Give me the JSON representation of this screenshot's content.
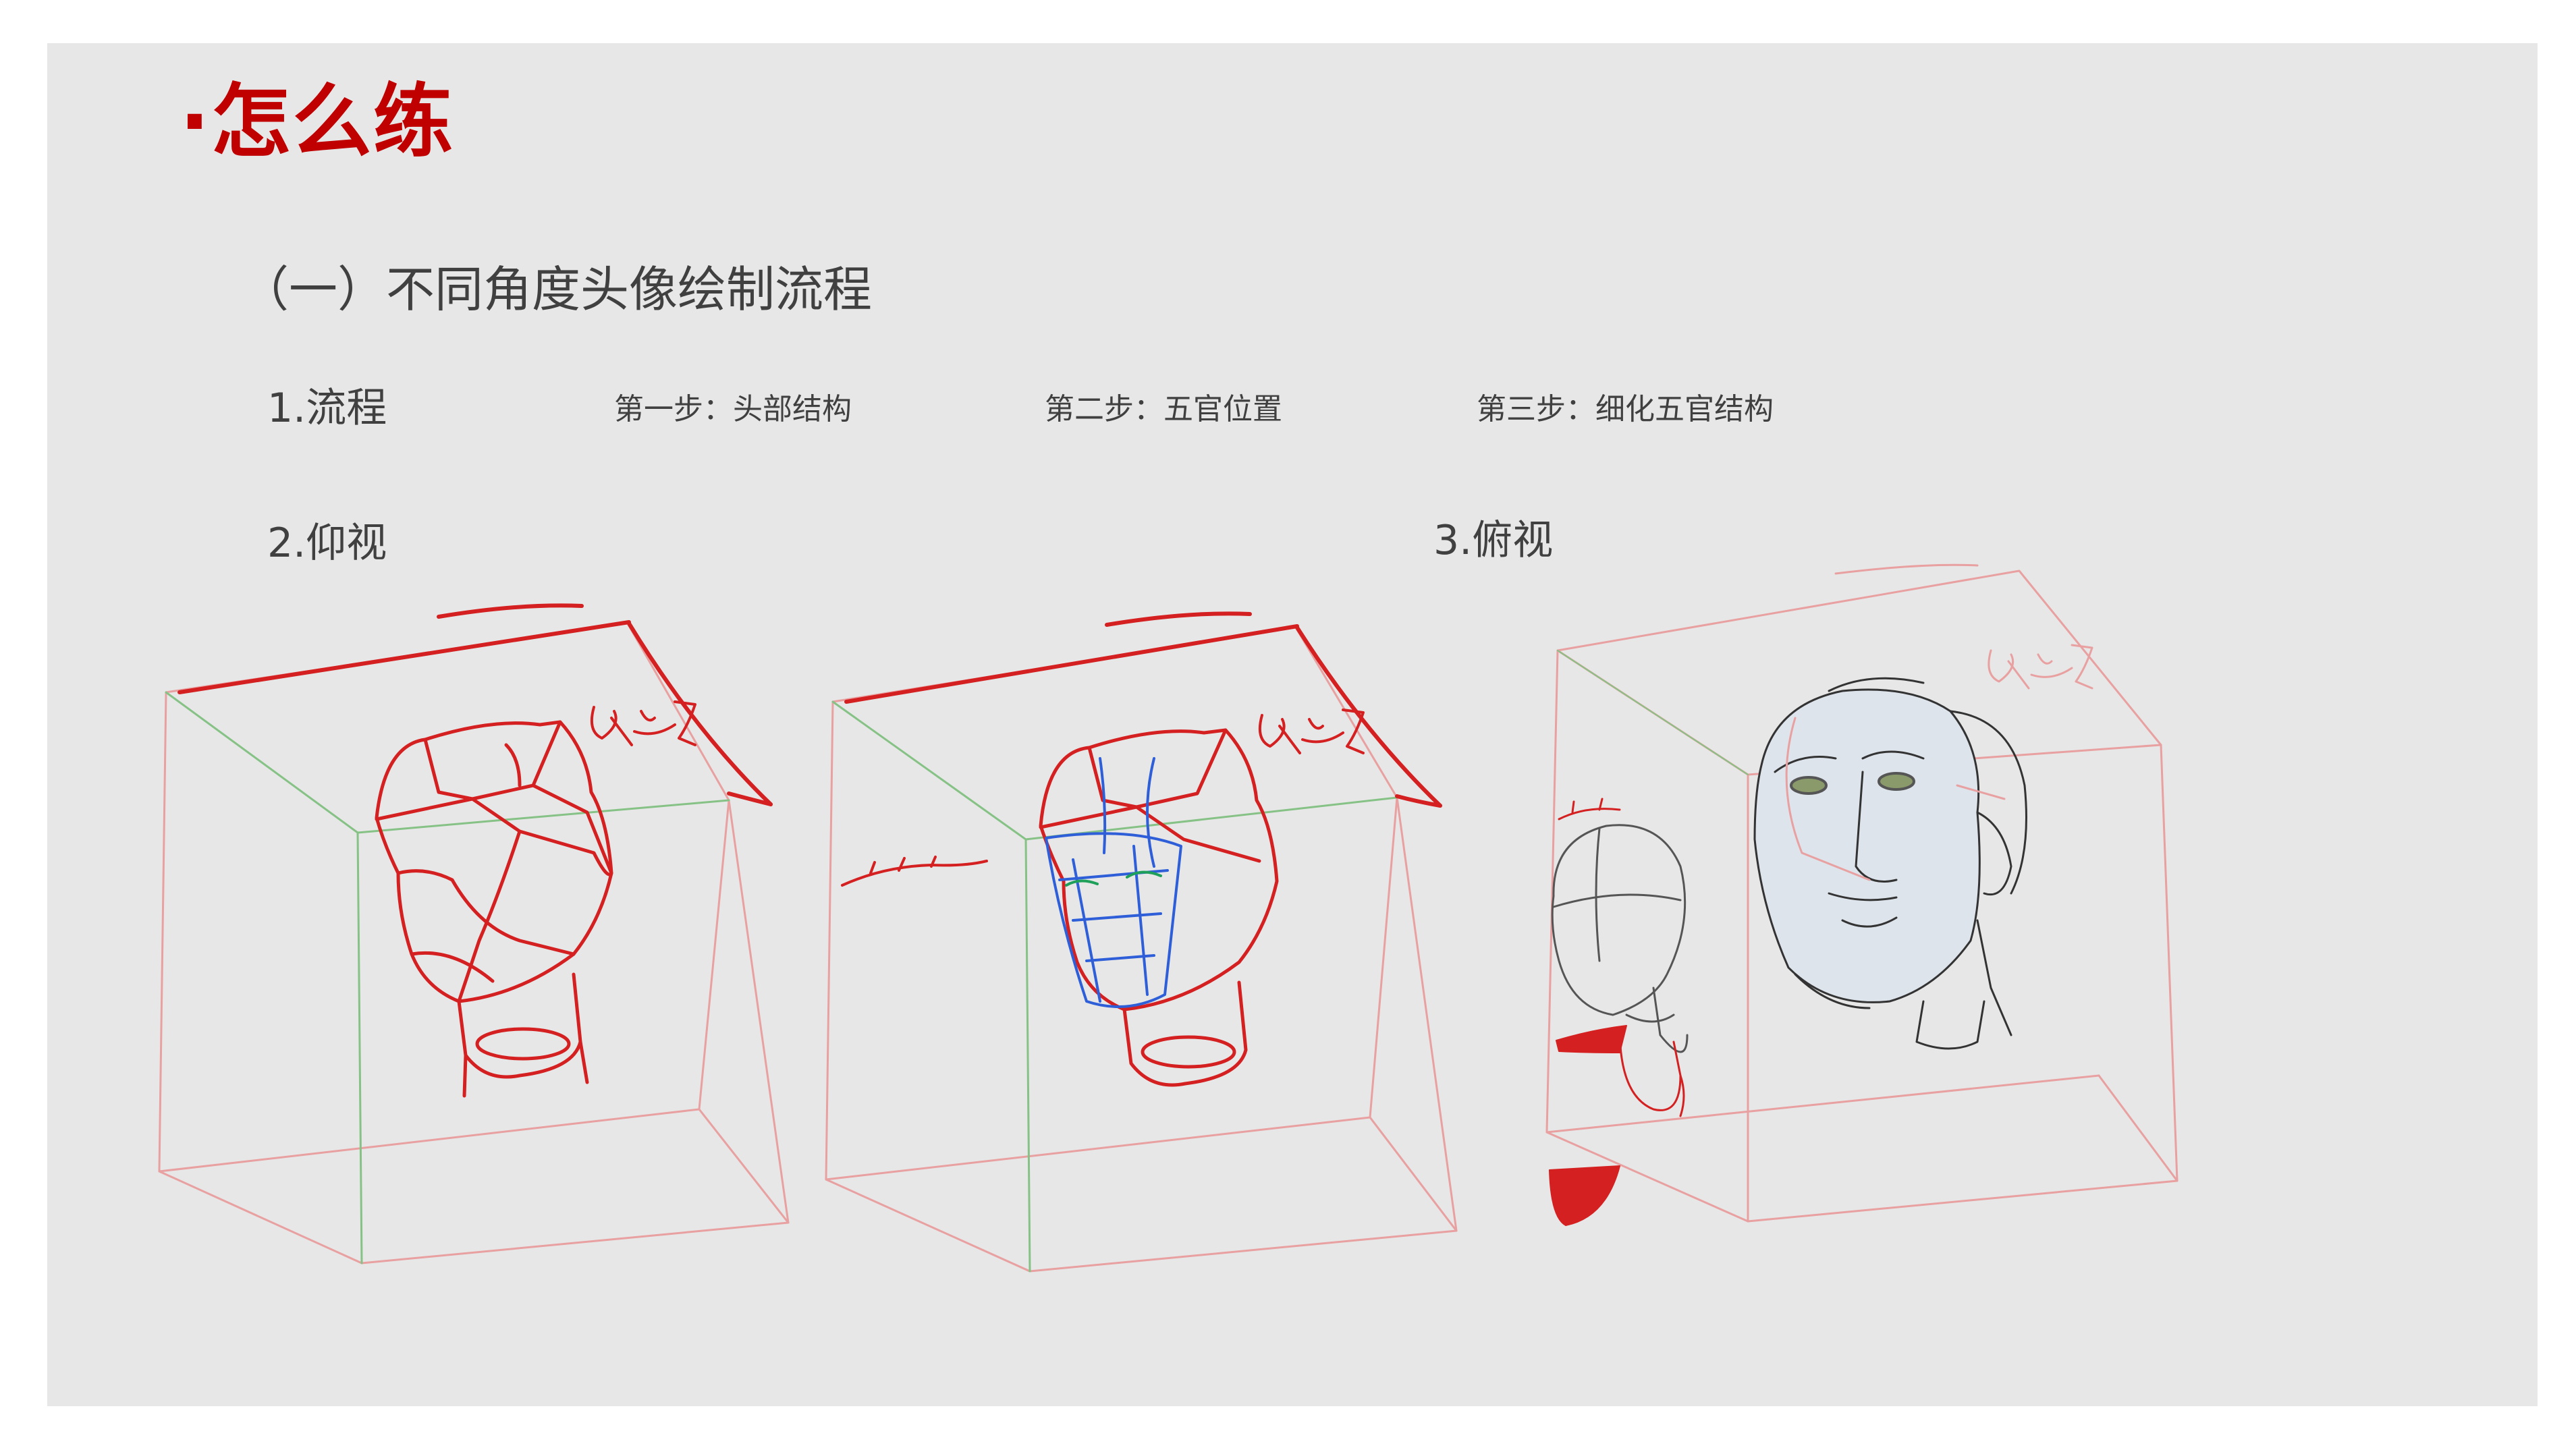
{
  "slide": {
    "title": "·怎么练",
    "subtitle": "（一）不同角度头像绘制流程",
    "process_label": "1.流程",
    "steps": [
      "第一步：头部结构",
      "第二步：五官位置",
      "第三步：细化五官结构"
    ],
    "upward_label": "2.仰视",
    "downward_label": "3.俯视"
  },
  "colors": {
    "slide_bg": "#e7e7e7",
    "title_red": "#c00000",
    "text_gray": "#404040",
    "sketch_red": "#d42020",
    "box_pink": "#e8a0a0",
    "guide_green": "#86c286",
    "feature_blue": "#2f5fd8",
    "feature_green": "#1fa05a",
    "pencil_gray": "#555555"
  }
}
